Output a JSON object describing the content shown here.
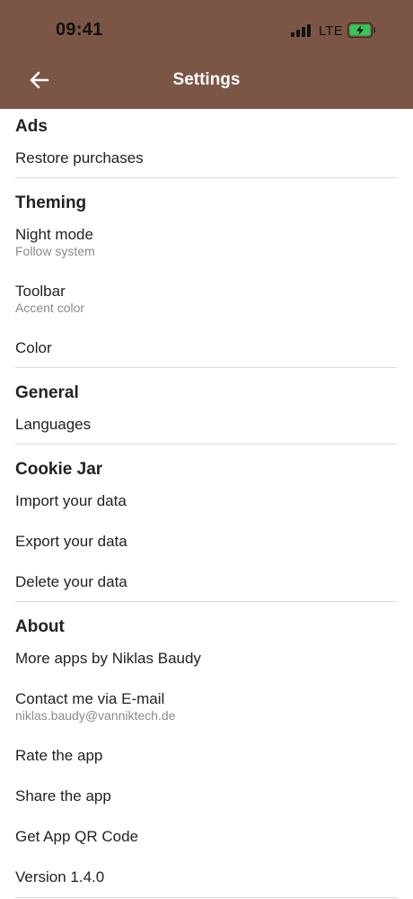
{
  "status_bar": {
    "time": "09:41",
    "network": "LTE"
  },
  "header": {
    "title": "Settings"
  },
  "sections": {
    "ads": {
      "title": "Ads",
      "items": [
        {
          "label": "Restore purchases"
        }
      ]
    },
    "theming": {
      "title": "Theming",
      "items": [
        {
          "label": "Night mode",
          "sub": "Follow system"
        },
        {
          "label": "Toolbar",
          "sub": "Accent color"
        },
        {
          "label": "Color"
        }
      ]
    },
    "general": {
      "title": "General",
      "items": [
        {
          "label": "Languages"
        }
      ]
    },
    "cookie_jar": {
      "title": "Cookie Jar",
      "items": [
        {
          "label": "Import your data"
        },
        {
          "label": "Export your data"
        },
        {
          "label": "Delete your data"
        }
      ]
    },
    "about": {
      "title": "About",
      "items": [
        {
          "label": "More apps by Niklas Baudy"
        },
        {
          "label": "Contact me via E-mail",
          "sub": "niklas.baudy@vanniktech.de"
        },
        {
          "label": "Rate the app"
        },
        {
          "label": "Share the app"
        },
        {
          "label": "Get App QR Code"
        },
        {
          "label": "Version 1.4.0"
        }
      ]
    }
  },
  "colors": {
    "toolbar": "#7b5646",
    "battery_fill": "#34c759"
  },
  "icons": {
    "back": "arrow-left-icon",
    "signal": "cellular-signal-icon",
    "battery": "battery-charging-icon"
  }
}
